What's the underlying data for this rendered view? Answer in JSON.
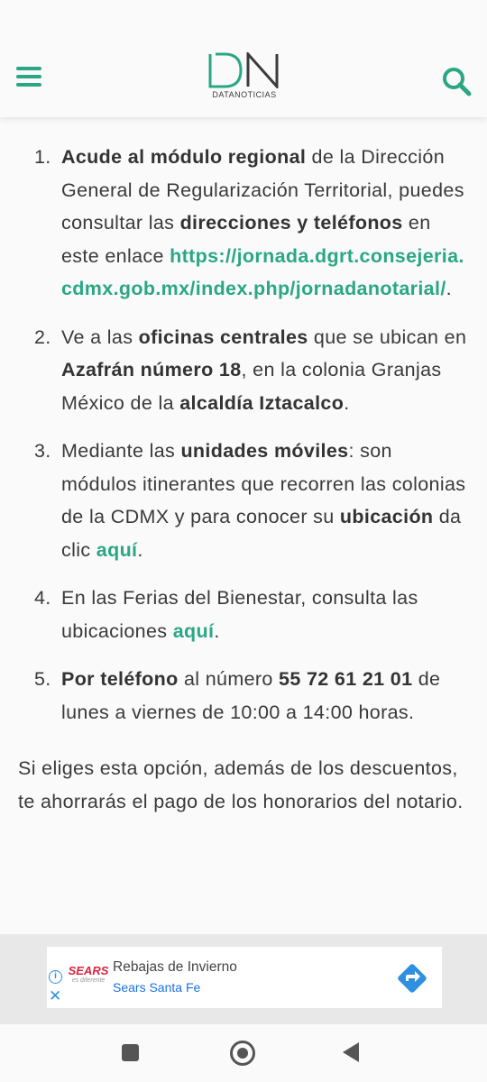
{
  "header": {
    "logo_letters": "DN",
    "logo_name": "DATANOTICIAS",
    "menu_icon": "hamburger-menu-icon",
    "search_icon": "search-icon",
    "accent_color": "#2aa785"
  },
  "steps": [
    {
      "number": "1.",
      "parts": [
        {
          "text": "Acude al módulo regional",
          "style": "bold"
        },
        {
          "text": " de la Dirección General de Regularización Territorial, puedes consultar las ",
          "style": "normal"
        },
        {
          "text": "direcciones y teléfonos",
          "style": "bold"
        },
        {
          "text": " en este enlace ",
          "style": "normal"
        },
        {
          "text": "https://jornada.dgrt.consejeria.cdmx.gob.mx/index.php/jornadanotarial/",
          "style": "link"
        },
        {
          "text": ".",
          "style": "normal"
        }
      ]
    },
    {
      "number": "2.",
      "parts": [
        {
          "text": "Ve a las ",
          "style": "normal"
        },
        {
          "text": "oficinas centrales",
          "style": "bold"
        },
        {
          "text": " que se ubican en ",
          "style": "normal"
        },
        {
          "text": "Azafrán número 18",
          "style": "bold"
        },
        {
          "text": ", en la colonia Granjas México de la ",
          "style": "normal"
        },
        {
          "text": "alcaldía Iztacalco",
          "style": "bold"
        },
        {
          "text": ".",
          "style": "normal"
        }
      ]
    },
    {
      "number": "3.",
      "parts": [
        {
          "text": "Mediante las ",
          "style": "normal"
        },
        {
          "text": "unidades móviles",
          "style": "bold"
        },
        {
          "text": ": son módulos itinerantes que recorren las colonias de la CDMX y para conocer su ",
          "style": "normal"
        },
        {
          "text": "ubicación",
          "style": "bold"
        },
        {
          "text": " da clic ",
          "style": "normal"
        },
        {
          "text": "aquí",
          "style": "link"
        },
        {
          "text": ".",
          "style": "normal"
        }
      ]
    },
    {
      "number": "4.",
      "parts": [
        {
          "text": "En las Ferias del Bienestar, consulta las ubicaciones ",
          "style": "normal"
        },
        {
          "text": "aquí",
          "style": "link"
        },
        {
          "text": ".",
          "style": "normal"
        }
      ]
    },
    {
      "number": "5.",
      "parts": [
        {
          "text": "Por teléfono",
          "style": "bold"
        },
        {
          "text": " al número ",
          "style": "normal"
        },
        {
          "text": "55 72 61 21 01",
          "style": "bold"
        },
        {
          "text": " de lunes a viernes de 10:00 a 14:00 horas.",
          "style": "normal"
        }
      ]
    }
  ],
  "closing": "Si eliges esta opción, además de los descuentos, te ahorrarás el pago de los honorarios del notario.",
  "ad": {
    "brand": "SEARS",
    "brand_tagline": "es diferente",
    "title": "Rebajas de Invierno",
    "subtitle": "Sears Santa Fe",
    "info_icon": "info-icon",
    "close_icon": "close-icon",
    "go_icon": "directions-arrow-icon",
    "go_color": "#2f8fe0"
  },
  "nav": {
    "recents_icon": "recents-square-icon",
    "home_icon": "home-circle-icon",
    "back_icon": "back-triangle-icon"
  }
}
